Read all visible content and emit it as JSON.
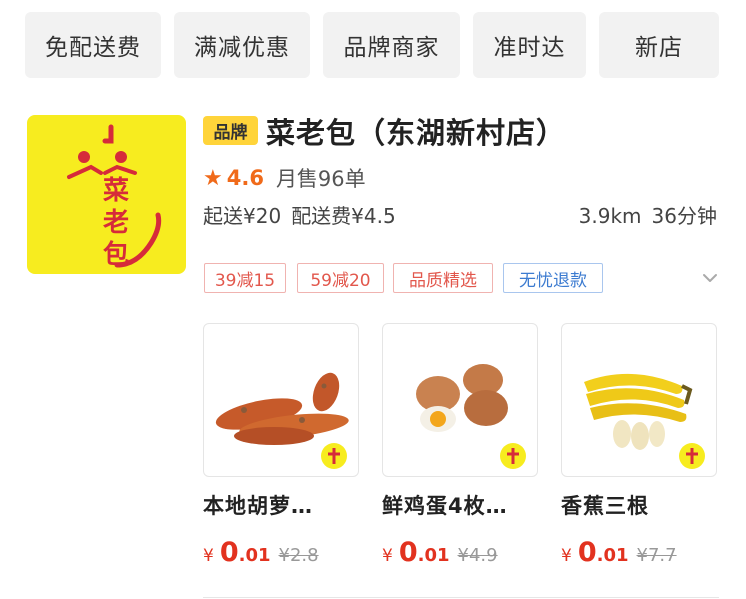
{
  "filters": [
    "免配送费",
    "满减优惠",
    "品牌商家",
    "准时达",
    "新店"
  ],
  "shop": {
    "logo_text": "菜老包",
    "badge": "品牌",
    "name": "菜老包（东湖新村店）",
    "rating": "4.6",
    "monthly_sales": "月售96单",
    "min_order": "起送¥20",
    "delivery_fee": "配送费¥4.5",
    "distance": "3.9km",
    "delivery_time": "36分钟",
    "tags": [
      {
        "label": "39减15",
        "style": "red"
      },
      {
        "label": "59减20",
        "style": "red"
      },
      {
        "label": "品质精选",
        "style": "red"
      },
      {
        "label": "无忧退款",
        "style": "blue"
      }
    ]
  },
  "products": [
    {
      "name": "本地胡萝…",
      "currency": "¥",
      "price_int": "0",
      "price_dec": ".01",
      "original_price": "¥2.8"
    },
    {
      "name": "鲜鸡蛋4枚…",
      "currency": "¥",
      "price_int": "0",
      "price_dec": ".01",
      "original_price": "¥4.9"
    },
    {
      "name": "香蕉三根",
      "currency": "¥",
      "price_int": "0",
      "price_dec": ".01",
      "original_price": "¥7.7"
    }
  ],
  "colors": {
    "accent_orange": "#f06a1a",
    "price_red": "#e2321f",
    "tag_red": "#e2574c",
    "tag_blue": "#3c7bd0",
    "brand_yellow": "#ffd43a",
    "logo_yellow": "#f7ec1f"
  },
  "icons": [
    "star-icon",
    "chevron-down-icon",
    "carrot-image",
    "eggs-image",
    "banana-image",
    "shop-logo"
  ]
}
